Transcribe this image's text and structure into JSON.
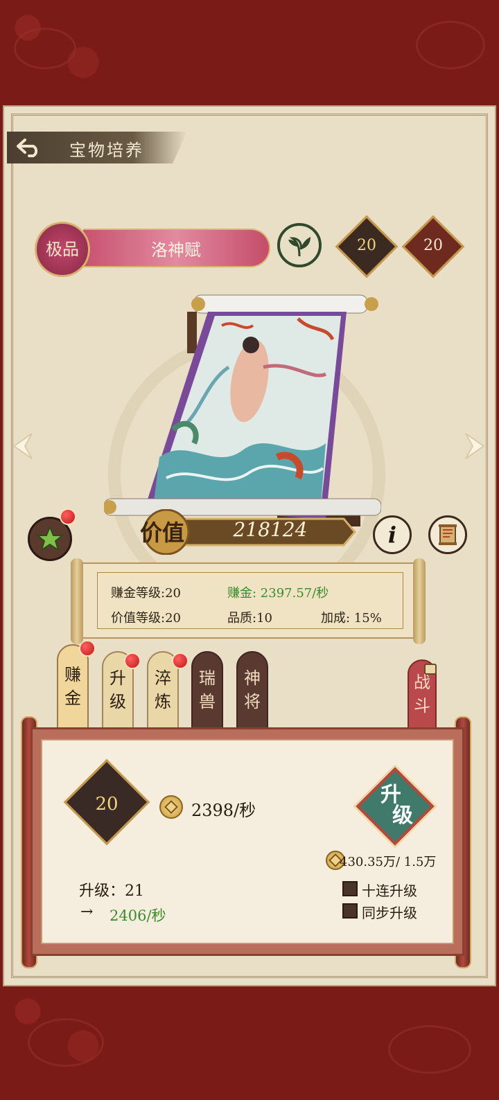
{
  "header": {
    "title": "宝物培养"
  },
  "treasure": {
    "grade": "极品",
    "name": "洛神赋",
    "level_a": "20",
    "level_b": "20",
    "value_label": "价值",
    "value": "218124"
  },
  "info": {
    "earn_level": "赚金等级:20",
    "earn_rate": "赚金: 2397.57/秒",
    "value_level": "价值等级:20",
    "quality": "品质:10",
    "bonus": "加成: 15%"
  },
  "tabs": [
    {
      "label_1": "赚",
      "label_2": "金"
    },
    {
      "label_1": "升",
      "label_2": "级"
    },
    {
      "label_1": "淬",
      "label_2": "炼"
    },
    {
      "label_1": "瑞",
      "label_2": "兽"
    },
    {
      "label_1": "神",
      "label_2": "将"
    },
    {
      "label_1": "战",
      "label_2": "斗"
    }
  ],
  "upgrade_panel": {
    "current_level": "20",
    "current_rate": "2398/秒",
    "button_label_1": "升",
    "button_label_2": "级",
    "cost": "430.35万/ 1.5万",
    "next_level": "升级：21",
    "arrow": "→",
    "next_rate": "2406/秒",
    "option_ten": "十连升级",
    "option_sync": "同步升级"
  },
  "colors": {
    "accent_green": "#3a8a2a",
    "brand_red": "#7b1b18",
    "parchment": "#e9dfc6"
  }
}
